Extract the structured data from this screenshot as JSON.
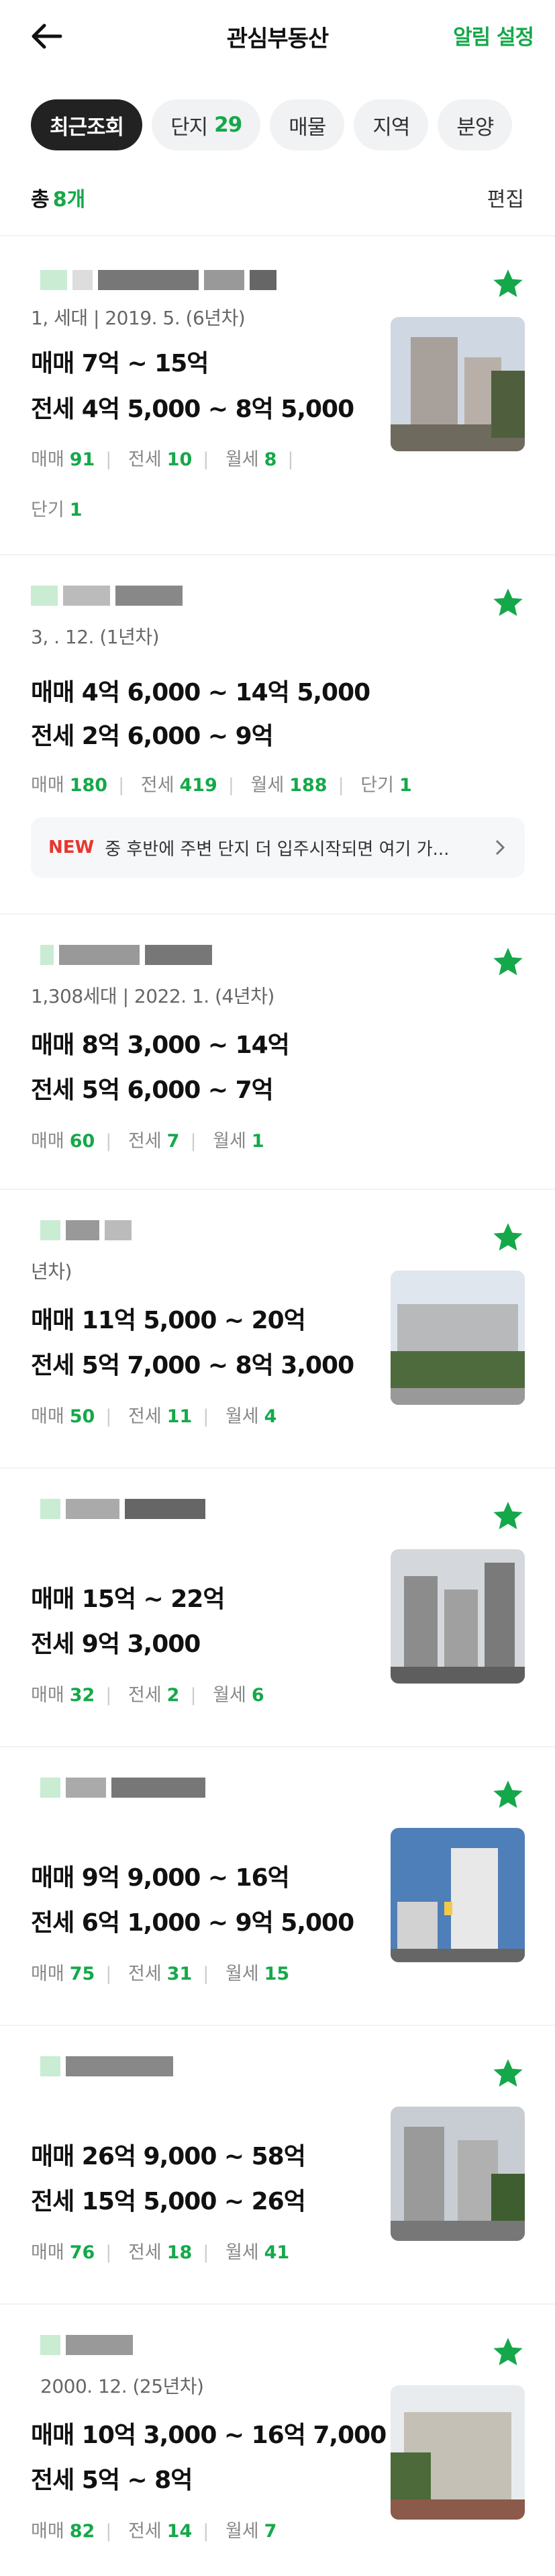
{
  "header": {
    "title": "관심부동산",
    "alarm_label": "알림 설정"
  },
  "tabs": [
    {
      "label": "최근조회",
      "count": ""
    },
    {
      "label": "단지",
      "count": "29"
    },
    {
      "label": "매물",
      "count": ""
    },
    {
      "label": "지역",
      "count": ""
    },
    {
      "label": "분양",
      "count": ""
    }
  ],
  "summary": {
    "total_label": "총",
    "total_count": "8개",
    "edit_label": "편집"
  },
  "items": [
    {
      "sub": "1,   세대 | 2019. 5. (6년차)",
      "sale": "매매 7억 ~ 15억",
      "rent": "전세 4억 5,000 ~ 8억 5,000",
      "stats": [
        {
          "l": "매매",
          "v": "91"
        },
        {
          "l": "전세",
          "v": "10"
        },
        {
          "l": "월세",
          "v": "8"
        },
        {
          "l": "단기",
          "v": "1"
        }
      ]
    },
    {
      "sub": "3,      . 12. (1년차)",
      "sale": "매매 4억 6,000 ~ 14억 5,000",
      "rent": "전세 2억 6,000 ~ 9억",
      "stats": [
        {
          "l": "매매",
          "v": "180"
        },
        {
          "l": "전세",
          "v": "419"
        },
        {
          "l": "월세",
          "v": "188"
        },
        {
          "l": "단기",
          "v": "1"
        }
      ],
      "new_badge": "NEW",
      "new_text": "중 후반에 주변 단지 더 입주시작되면 여기 가..."
    },
    {
      "sub": "1,308세대 | 2022. 1. (4년차)",
      "sale": "매매 8억 3,000 ~ 14억",
      "rent": "전세 5억 6,000 ~ 7억",
      "stats": [
        {
          "l": "매매",
          "v": "60"
        },
        {
          "l": "전세",
          "v": "7"
        },
        {
          "l": "월세",
          "v": "1"
        }
      ]
    },
    {
      "sub": "                  년차)",
      "sale": "매매 11억 5,000 ~ 20억",
      "rent": "전세 5억 7,000 ~ 8억 3,000",
      "stats": [
        {
          "l": "매매",
          "v": "50"
        },
        {
          "l": "전세",
          "v": "11"
        },
        {
          "l": "월세",
          "v": "4"
        }
      ]
    },
    {
      "sub": "",
      "sale": "매매 15억 ~ 22억",
      "rent": "전세 9억 3,000",
      "stats": [
        {
          "l": "매매",
          "v": "32"
        },
        {
          "l": "전세",
          "v": "2"
        },
        {
          "l": "월세",
          "v": "6"
        }
      ]
    },
    {
      "sub": "",
      "sale": "매매 9억 9,000 ~ 16억",
      "rent": "전세 6억 1,000 ~ 9억 5,000",
      "stats": [
        {
          "l": "매매",
          "v": "75"
        },
        {
          "l": "전세",
          "v": "31"
        },
        {
          "l": "월세",
          "v": "15"
        }
      ]
    },
    {
      "sub": "",
      "sale": "매매 26억 9,000 ~ 58억",
      "rent": "전세 15억 5,000 ~ 26억",
      "stats": [
        {
          "l": "매매",
          "v": "76"
        },
        {
          "l": "전세",
          "v": "18"
        },
        {
          "l": "월세",
          "v": "41"
        }
      ]
    },
    {
      "sub": "2000. 12. (25년차)",
      "sale": "매매 10억 3,000 ~ 16억 7,000",
      "rent": "전세 5억 ~ 8억",
      "stats": [
        {
          "l": "매매",
          "v": "82"
        },
        {
          "l": "전세",
          "v": "14"
        },
        {
          "l": "월세",
          "v": "7"
        }
      ]
    }
  ],
  "colors": {
    "accent": "#15a84a",
    "star": "#15a84a",
    "new": "#e8362f"
  }
}
